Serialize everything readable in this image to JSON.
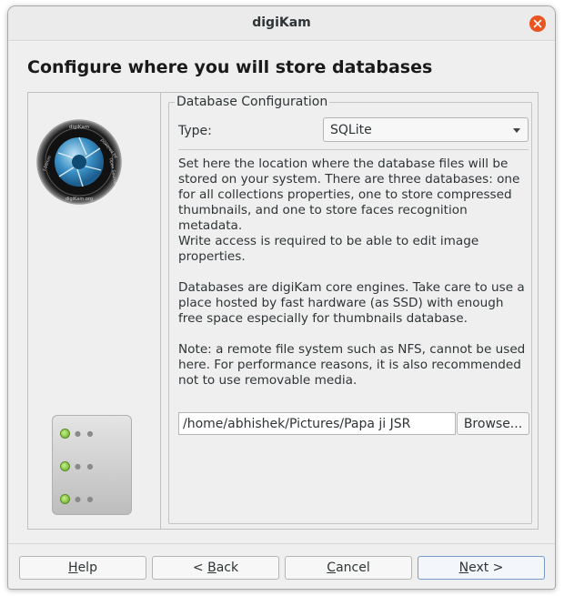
{
  "window": {
    "title": "digiKam"
  },
  "page": {
    "heading": "Configure where you will store databases"
  },
  "group": {
    "title": "Database Configuration",
    "type_label": "Type:",
    "type_value": "SQLite",
    "description_1": "Set here the location where the database files will be stored on your system. There are three databases: one for all collections properties, one to store compressed thumbnails, and one to store faces recognition metadata.",
    "description_2": "Write access is required to be able to edit image properties.",
    "description_3": "Databases are digiKam core engines. Take care to use a place hosted by fast hardware (as SSD) with enough free space especially for thumbnails database.",
    "description_4": "Note: a remote file system such as NFS, cannot be used here. For performance reasons, it is also recommended not to use removable media.",
    "path_value": "/home/abhishek/Pictures/Papa ji JSR",
    "browse_label": "Browse..."
  },
  "buttons": {
    "help": {
      "mnemonic": "H",
      "rest": "elp"
    },
    "back": {
      "prefix": "< ",
      "mnemonic": "B",
      "rest": "ack"
    },
    "cancel": {
      "mnemonic": "C",
      "rest": "ancel"
    },
    "next": {
      "mnemonic": "N",
      "rest": "ext >"
    }
  },
  "logo": {
    "text_top": "digiKam",
    "text_left": "f-50mm",
    "text_right": "powered by",
    "text_right2": "Open Source",
    "text_bottom": "digiKam.org"
  },
  "colors": {
    "close": "#e95420",
    "led": "#7cc93a",
    "accent": "#7a9bc5"
  }
}
